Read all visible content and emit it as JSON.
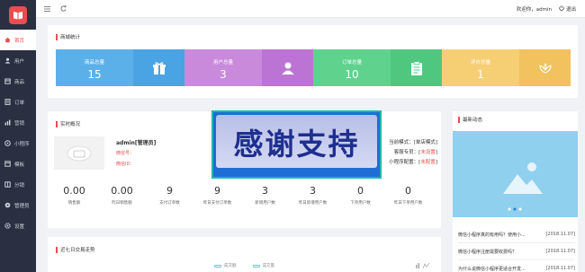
{
  "sidebar": {
    "items": [
      {
        "label": "首页",
        "icon": "home-icon"
      },
      {
        "label": "用户",
        "icon": "user-icon"
      },
      {
        "label": "商品",
        "icon": "goods-icon"
      },
      {
        "label": "订单",
        "icon": "order-icon"
      },
      {
        "label": "营销",
        "icon": "marketing-icon"
      },
      {
        "label": "小程序",
        "icon": "miniprogram-icon"
      },
      {
        "label": "模板",
        "icon": "template-icon"
      },
      {
        "label": "分销",
        "icon": "distribution-icon"
      },
      {
        "label": "管理员",
        "icon": "admin-icon"
      },
      {
        "label": "设置",
        "icon": "settings-icon"
      }
    ]
  },
  "topbar": {
    "welcome": "欢迎你，admin",
    "logout": "退出"
  },
  "stats": {
    "title": "商城统计",
    "items": [
      {
        "label": "商品总量",
        "value": "15",
        "color": "#5cb0ea",
        "icon_color": "#4aa3e2"
      },
      {
        "label": "用户总量",
        "value": "3",
        "color": "#c98adc",
        "icon_color": "#bc74d4"
      },
      {
        "label": "订单总量",
        "value": "10",
        "color": "#5fd28e",
        "icon_color": "#4fc77f"
      },
      {
        "label": "评价总量",
        "value": "1",
        "color": "#f6cf75",
        "icon_color": "#f1c25d"
      }
    ]
  },
  "live": {
    "title": "实时概况",
    "profile_name": "admin[管理员]",
    "line1": "微信号：",
    "line2": "微信ID：",
    "mode": "当前模式：[",
    "mode_value": "单店模式",
    "mode_end": "]",
    "service": "客服专员：[",
    "service_value": "未设置",
    "service_end": "]",
    "mini": "小程序配置：[",
    "mini_value": "未配置",
    "mini_end": "]",
    "metrics": [
      {
        "value": "0.00",
        "label": "销售额"
      },
      {
        "value": "0.00",
        "label": "昨日销售额"
      },
      {
        "value": "9",
        "label": "支付订单数"
      },
      {
        "value": "9",
        "label": "昨日支付订单数"
      },
      {
        "value": "3",
        "label": "新增用户数"
      },
      {
        "value": "3",
        "label": "昨日新增用户数"
      },
      {
        "value": "0",
        "label": "下单用户数"
      },
      {
        "value": "0",
        "label": "昨日下单用户数"
      }
    ]
  },
  "banner": {
    "text": "感谢支持"
  },
  "trend": {
    "title": "近七日交易走势",
    "legend": [
      "成交额",
      "成交量"
    ]
  },
  "news": {
    "title": "最新动态",
    "items": [
      {
        "title": "微信小程序真的有用吗？使用小...",
        "date": "[2018.11.07]"
      },
      {
        "title": "微信小程序注册需要收费吗？",
        "date": "[2018.11.07]"
      },
      {
        "title": "为什么说微信小程序更适合开发...",
        "date": "[2018.11.07]"
      }
    ]
  }
}
